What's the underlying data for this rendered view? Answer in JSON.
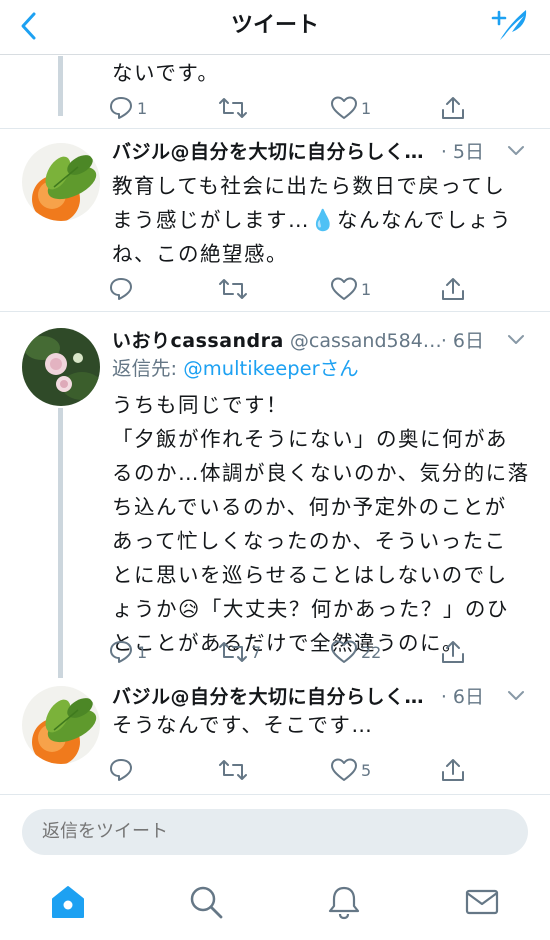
{
  "header": {
    "title": "ツイート"
  },
  "tweet_prev": {
    "text": "ないです。",
    "actions": {
      "reply": "1",
      "retweet": "",
      "like": "1"
    }
  },
  "tweets": [
    {
      "name": "バジル@自分を大切に自分らしく…",
      "handle": "",
      "time": "· 5日",
      "text": "教育しても社会に出たら数日で戻ってし\nまう感じがします…💧なんなんでしょう\nね、この絶望感。",
      "actions": {
        "reply": "",
        "retweet": "",
        "like": "1"
      }
    },
    {
      "name": "いおりcassandra",
      "handle": "@cassand584…",
      "time": "· 6日",
      "reply_label": "返信先: ",
      "reply_mention": "@multikeeper",
      "reply_suffix": "さん",
      "text": "うちも同じです！\n「夕飯が作れそうにない」の奥に何があ\nるのか…体調が良くないのか、気分的に落\nち込んでいるのか、何か予定外のことが\nあって忙しくなったのか、そういったこ\nとに思いを巡らせることはしないのでし\nょうか😥「大丈夫？何かあった？」のひ\nとことがあるだけで全然違うのに。",
      "actions": {
        "reply": "1",
        "retweet": "7",
        "like": "22"
      }
    },
    {
      "name": "バジル@自分を大切に自分らしく…",
      "handle": "",
      "time": "· 6日",
      "text": "そうなんです、そこです…",
      "actions": {
        "reply": "",
        "retweet": "",
        "like": "5"
      }
    }
  ],
  "reply_bar": {
    "placeholder": "返信をツイート"
  },
  "tabbar": {
    "items": [
      "home-icon",
      "search-icon",
      "notifications-icon",
      "messages-icon"
    ]
  },
  "colors": {
    "accent": "#1da1f2",
    "muted": "#657786",
    "line": "#ccd6dd"
  }
}
